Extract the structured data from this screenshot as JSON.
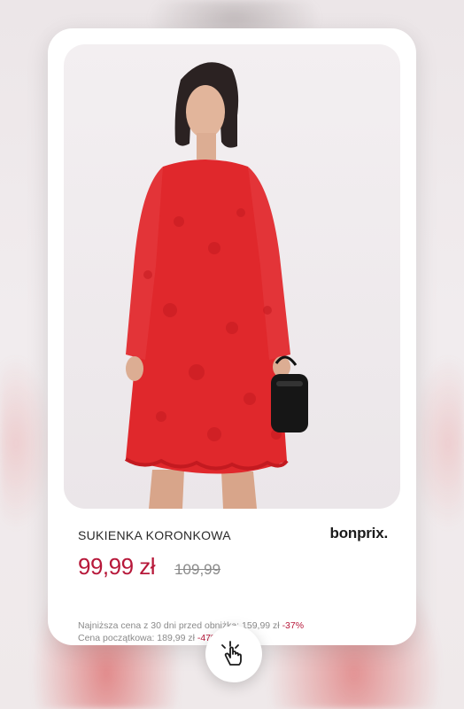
{
  "product": {
    "title": "SUKIENKA KORONKOWA",
    "brand": "bonprix.",
    "price": "99,99 zł",
    "old_price": "109,99",
    "lowest_price_label": "Najniższa cena z 30 dni  przed obniżką: 159,99 zł",
    "lowest_price_discount": "-37%",
    "initial_price_label": "Cena początkowa: 189,99 zł",
    "initial_price_discount": "-47%",
    "image_icon": "red-lace-dress-photo"
  },
  "colors": {
    "price": "#b7183a",
    "dress": "#e0282c",
    "card": "#ffffff"
  },
  "tap_button": {
    "icon": "hand-tap-icon"
  }
}
